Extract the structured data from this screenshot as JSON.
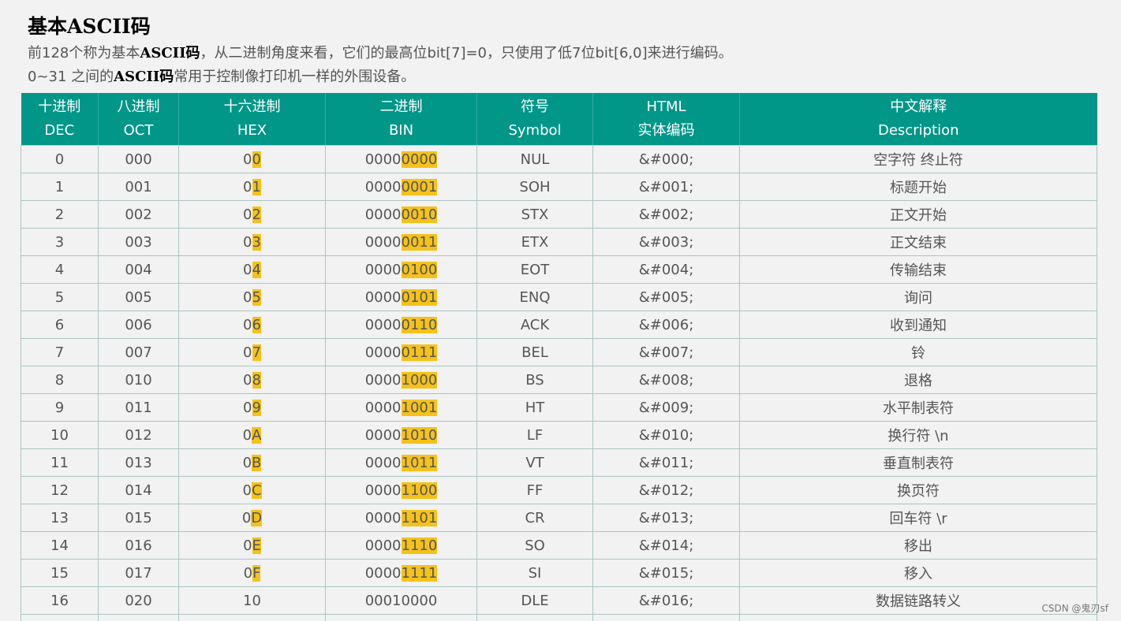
{
  "title": "基本ASCII码",
  "intro": {
    "line1": {
      "prefix": "前128个称为基本",
      "bold": "ASCII码",
      "suffix": "，从二进制角度来看，它们的最高位bit[7]=0，只使用了低7位bit[6,0]来进行编码。"
    },
    "line2": {
      "prefix": "0~31 之间的",
      "bold": "ASCII码",
      "suffix": "常用于控制像打印机一样的外围设备。"
    }
  },
  "table": {
    "headers": [
      {
        "cn": "十进制",
        "en": "DEC"
      },
      {
        "cn": "八进制",
        "en": "OCT"
      },
      {
        "cn": "十六进制",
        "en": "HEX"
      },
      {
        "cn": "二进制",
        "en": "BIN"
      },
      {
        "cn": "符号",
        "en": "Symbol"
      },
      {
        "cn": "HTML",
        "en": "实体编码"
      },
      {
        "cn": "中文解释",
        "en": "Description"
      }
    ],
    "rows": [
      {
        "dec": "0",
        "oct": "000",
        "hex_a": "0",
        "hex_b": "0",
        "bin_a": "0000",
        "bin_b": "0000",
        "sym": "NUL",
        "html": "&#000;",
        "desc": "空字符 终止符"
      },
      {
        "dec": "1",
        "oct": "001",
        "hex_a": "0",
        "hex_b": "1",
        "bin_a": "0000",
        "bin_b": "0001",
        "sym": "SOH",
        "html": "&#001;",
        "desc": "标题开始"
      },
      {
        "dec": "2",
        "oct": "002",
        "hex_a": "0",
        "hex_b": "2",
        "bin_a": "0000",
        "bin_b": "0010",
        "sym": "STX",
        "html": "&#002;",
        "desc": "正文开始"
      },
      {
        "dec": "3",
        "oct": "003",
        "hex_a": "0",
        "hex_b": "3",
        "bin_a": "0000",
        "bin_b": "0011",
        "sym": "ETX",
        "html": "&#003;",
        "desc": "正文结束"
      },
      {
        "dec": "4",
        "oct": "004",
        "hex_a": "0",
        "hex_b": "4",
        "bin_a": "0000",
        "bin_b": "0100",
        "sym": "EOT",
        "html": "&#004;",
        "desc": "传输结束"
      },
      {
        "dec": "5",
        "oct": "005",
        "hex_a": "0",
        "hex_b": "5",
        "bin_a": "0000",
        "bin_b": "0101",
        "sym": "ENQ",
        "html": "&#005;",
        "desc": "询问"
      },
      {
        "dec": "6",
        "oct": "006",
        "hex_a": "0",
        "hex_b": "6",
        "bin_a": "0000",
        "bin_b": "0110",
        "sym": "ACK",
        "html": "&#006;",
        "desc": "收到通知"
      },
      {
        "dec": "7",
        "oct": "007",
        "hex_a": "0",
        "hex_b": "7",
        "bin_a": "0000",
        "bin_b": "0111",
        "sym": "BEL",
        "html": "&#007;",
        "desc": "铃"
      },
      {
        "dec": "8",
        "oct": "010",
        "hex_a": "0",
        "hex_b": "8",
        "bin_a": "0000",
        "bin_b": "1000",
        "sym": "BS",
        "html": "&#008;",
        "desc": "退格"
      },
      {
        "dec": "9",
        "oct": "011",
        "hex_a": "0",
        "hex_b": "9",
        "bin_a": "0000",
        "bin_b": "1001",
        "sym": "HT",
        "html": "&#009;",
        "desc": "水平制表符"
      },
      {
        "dec": "10",
        "oct": "012",
        "hex_a": "0",
        "hex_b": "A",
        "bin_a": "0000",
        "bin_b": "1010",
        "sym": "LF",
        "html": "&#010;",
        "desc": "换行符 \\n"
      },
      {
        "dec": "11",
        "oct": "013",
        "hex_a": "0",
        "hex_b": "B",
        "bin_a": "0000",
        "bin_b": "1011",
        "sym": "VT",
        "html": "&#011;",
        "desc": "垂直制表符"
      },
      {
        "dec": "12",
        "oct": "014",
        "hex_a": "0",
        "hex_b": "C",
        "bin_a": "0000",
        "bin_b": "1100",
        "sym": "FF",
        "html": "&#012;",
        "desc": "换页符"
      },
      {
        "dec": "13",
        "oct": "015",
        "hex_a": "0",
        "hex_b": "D",
        "bin_a": "0000",
        "bin_b": "1101",
        "sym": "CR",
        "html": "&#013;",
        "desc": "回车符 \\r"
      },
      {
        "dec": "14",
        "oct": "016",
        "hex_a": "0",
        "hex_b": "E",
        "bin_a": "0000",
        "bin_b": "1110",
        "sym": "SO",
        "html": "&#014;",
        "desc": "移出"
      },
      {
        "dec": "15",
        "oct": "017",
        "hex_a": "0",
        "hex_b": "F",
        "bin_a": "0000",
        "bin_b": "1111",
        "sym": "SI",
        "html": "&#015;",
        "desc": "移入"
      },
      {
        "dec": "16",
        "oct": "020",
        "hex_a": "10",
        "hex_b": "",
        "bin_a": "00010000",
        "bin_b": "",
        "sym": "DLE",
        "html": "&#016;",
        "desc": "数据链路转义"
      },
      {
        "dec": "",
        "oct": "",
        "hex_a": "",
        "hex_b": "",
        "bin_a": "",
        "bin_b": "",
        "sym": "",
        "html": "",
        "desc": ""
      }
    ]
  },
  "watermark": "CSDN @鬼刃sf",
  "colors": {
    "header_bg": "#009688",
    "highlight": "#f5c21a",
    "page_bg": "#f2f2f2",
    "border": "#a9c6c2"
  }
}
